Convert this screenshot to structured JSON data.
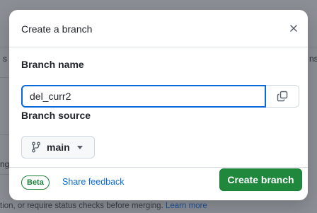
{
  "dialog": {
    "title": "Create a branch",
    "close_icon": "close-icon"
  },
  "branch_name": {
    "label": "Branch name",
    "value": "del_curr2",
    "copy_icon": "copy-icon"
  },
  "branch_source": {
    "label": "Branch source",
    "selected": "main",
    "branch_icon": "git-branch-icon",
    "caret_icon": "triangle-down-icon"
  },
  "footer": {
    "beta_label": "Beta",
    "feedback_label": "Share feedback",
    "create_label": "Create branch"
  },
  "background": {
    "left_glyph": "s",
    "right_glyph": "ns",
    "ng_glyph": "ng",
    "bottom_text": "tion, or require status checks before merging.",
    "bottom_link": "Learn more"
  },
  "colors": {
    "accent_blue": "#0969da",
    "primary_green": "#1f883d",
    "beta_green": "#1a7f37"
  }
}
